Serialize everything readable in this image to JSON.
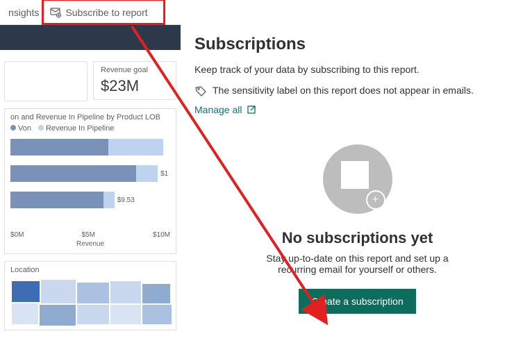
{
  "toolbar": {
    "insights_label": "nsights",
    "subscribe_label": "Subscribe to report"
  },
  "cards": {
    "revenue_goal": {
      "label": "Revenue goal",
      "value": "$23M"
    }
  },
  "chart_data": {
    "type": "bar",
    "title": "on and Revenue In Pipeline by Product LOB",
    "legend_a": "Von",
    "legend_b": "Revenue In Pipeline",
    "color_a": "#7a92b8",
    "color_b": "#bed3f0",
    "series": [
      {
        "name": "Von",
        "values": [
          9.0,
          11.5,
          8.5
        ]
      },
      {
        "name": "Revenue In Pipeline",
        "values": [
          5.0,
          2.0,
          1.03
        ]
      }
    ],
    "value_labels": [
      "",
      "$1",
      "$9.53"
    ],
    "xlabel": "Revenue",
    "x_ticks": [
      "$0M",
      "$5M",
      "$10M"
    ],
    "xlim": [
      0,
      14
    ]
  },
  "map": {
    "title": "Location"
  },
  "panel": {
    "title": "Subscriptions",
    "subtitle": "Keep track of your data by subscribing to this report.",
    "info": "The sensitivity label on this report does not appear in emails.",
    "manage_label": "Manage all",
    "empty_title": "No subscriptions yet",
    "empty_body": "Stay up-to-date on this report and set up a recurring email for yourself or others.",
    "create_label": "Create a subscription"
  }
}
